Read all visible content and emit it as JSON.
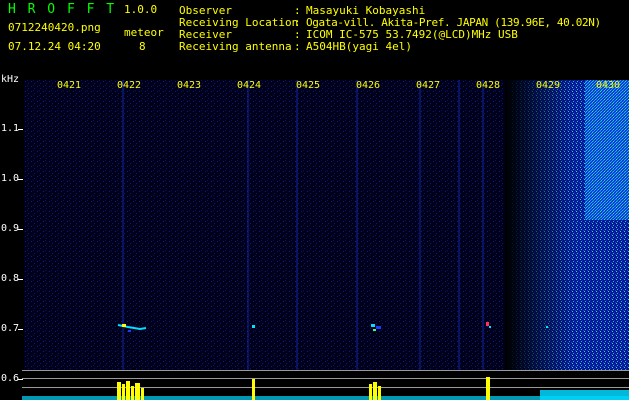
{
  "header": {
    "app_name": "H R O F F T",
    "version": "1.0.0",
    "filename": "0712240420.png",
    "datetime": "07.12.24 04:20",
    "meteor_label": "meteor",
    "meteor_count": "8"
  },
  "info": {
    "rows": [
      {
        "key": "Observer",
        "sep": ":",
        "value": "Masayuki Kobayashi"
      },
      {
        "key": "Receiving Location",
        "sep": ":",
        "value": "Ogata-vill. Akita-Pref. JAPAN (139.96E, 40.02N)"
      },
      {
        "key": "Receiver",
        "sep": ":",
        "value": "ICOM IC-575 53.7492(@LCD)MHz USB"
      },
      {
        "key": "Receiving antenna",
        "sep": ":",
        "value": "A504HB(yagi 4el)"
      }
    ]
  },
  "y_axis": {
    "unit": "kHz",
    "ticks": [
      "1.1",
      "1.0",
      "0.9",
      "0.8",
      "0.7",
      "0.6"
    ]
  },
  "x_axis": {
    "ticks": [
      "0421",
      "0422",
      "0423",
      "0424",
      "0425",
      "0426",
      "0427",
      "0428",
      "0429",
      "0430"
    ]
  },
  "colors": {
    "background": "#000000",
    "header_green": "#00ff00",
    "header_yellow": "#ffff00",
    "signal_blue": "#1a3cff",
    "signal_cyan": "#00e0ff",
    "meteor_yellow": "#ffff00"
  }
}
